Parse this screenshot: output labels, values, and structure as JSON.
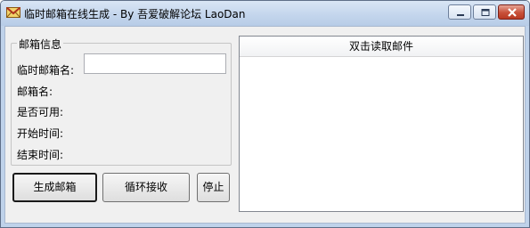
{
  "window": {
    "title": "临时邮箱在线生成  - By 吾爱破解论坛 LaoDan",
    "icon": "mail-envelope-icon"
  },
  "caption_buttons": [
    "minimize-icon",
    "maximize-icon",
    "close-icon"
  ],
  "mailbox_group": {
    "title": "邮箱信息",
    "temp_name_label": "临时邮箱名:",
    "temp_name_value": "",
    "mailbox_name_label": "邮箱名:",
    "available_label": "是否可用:",
    "start_time_label": "开始时间:",
    "end_time_label": "结束时间:"
  },
  "buttons": {
    "generate": "生成邮箱",
    "loop_receive": "循环接收",
    "stop": "停止"
  },
  "mail_list": {
    "header": "双击读取邮件",
    "items": []
  }
}
